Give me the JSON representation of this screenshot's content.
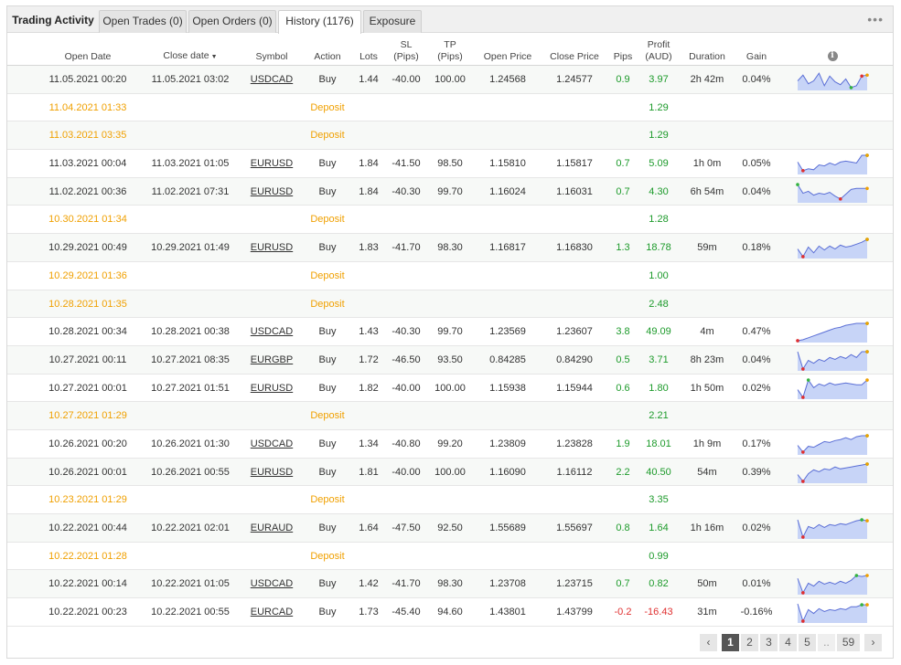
{
  "tabs": [
    {
      "label": "Trading Activity"
    },
    {
      "label": "Open Trades (0)"
    },
    {
      "label": "Open Orders (0)"
    },
    {
      "label": "History (1176)"
    },
    {
      "label": "Exposure"
    }
  ],
  "more_icon": "more-horizontal-icon",
  "columns": {
    "open_date": "Open Date",
    "close_date": "Close date",
    "symbol": "Symbol",
    "action": "Action",
    "lots": "Lots",
    "sl": "SL",
    "sl_unit": "(Pips)",
    "tp": "TP",
    "tp_unit": "(Pips)",
    "open_price": "Open Price",
    "close_price": "Close Price",
    "pips": "Pips",
    "profit": "Profit",
    "profit_unit": "(AUD)",
    "duration": "Duration",
    "gain": "Gain",
    "chart_icon": "info-icon"
  },
  "rows": [
    {
      "type": "trade",
      "open_date": "11.05.2021 00:20",
      "close_date": "11.05.2021 03:02",
      "symbol": "USDCAD",
      "action": "Buy",
      "lots": "1.44",
      "sl": "-40.00",
      "tp": "100.00",
      "open_price": "1.24568",
      "close_price": "1.24577",
      "pips": "0.9",
      "profit": "3.97",
      "duration": "2h 42m",
      "gain": "0.04%",
      "spark": [
        0.55,
        0.25,
        0.7,
        0.55,
        0.15,
        0.8,
        0.3,
        0.6,
        0.75,
        0.45,
        0.9,
        0.8,
        0.3,
        0.25
      ],
      "spark_max": 10,
      "spark_min": 12
    },
    {
      "type": "deposit",
      "open_date": "11.04.2021 01:33",
      "action": "Deposit",
      "profit": "1.29"
    },
    {
      "type": "deposit",
      "open_date": "11.03.2021 03:35",
      "action": "Deposit",
      "profit": "1.29"
    },
    {
      "type": "trade",
      "open_date": "11.03.2021 00:04",
      "close_date": "11.03.2021 01:05",
      "symbol": "EURUSD",
      "action": "Buy",
      "lots": "1.84",
      "sl": "-41.50",
      "tp": "98.50",
      "open_price": "1.15810",
      "close_price": "1.15817",
      "pips": "0.7",
      "profit": "5.09",
      "duration": "1h 0m",
      "gain": "0.05%",
      "spark": [
        0.4,
        0.85,
        0.75,
        0.8,
        0.55,
        0.6,
        0.45,
        0.55,
        0.4,
        0.35,
        0.4,
        0.45,
        0.05,
        0.05
      ],
      "spark_max": 13,
      "spark_min": 1
    },
    {
      "type": "trade",
      "open_date": "11.02.2021 00:36",
      "close_date": "11.02.2021 07:31",
      "symbol": "EURUSD",
      "action": "Buy",
      "lots": "1.84",
      "sl": "-40.30",
      "tp": "99.70",
      "open_price": "1.16024",
      "close_price": "1.16031",
      "pips": "0.7",
      "profit": "4.30",
      "duration": "6h 54m",
      "gain": "0.04%",
      "spark": [
        0.1,
        0.55,
        0.45,
        0.65,
        0.55,
        0.6,
        0.5,
        0.7,
        0.85,
        0.6,
        0.35,
        0.3,
        0.3,
        0.3
      ],
      "spark_max": 0,
      "spark_min": 8
    },
    {
      "type": "deposit",
      "open_date": "10.30.2021 01:34",
      "action": "Deposit",
      "profit": "1.28"
    },
    {
      "type": "trade",
      "open_date": "10.29.2021 00:49",
      "close_date": "10.29.2021 01:49",
      "symbol": "EURUSD",
      "action": "Buy",
      "lots": "1.83",
      "sl": "-41.70",
      "tp": "98.30",
      "open_price": "1.16817",
      "close_price": "1.16830",
      "pips": "1.3",
      "profit": "18.78",
      "duration": "59m",
      "gain": "0.18%",
      "spark": [
        0.55,
        0.95,
        0.45,
        0.75,
        0.4,
        0.6,
        0.4,
        0.55,
        0.35,
        0.45,
        0.4,
        0.3,
        0.2,
        0.05
      ],
      "spark_max": 13,
      "spark_min": 1
    },
    {
      "type": "deposit",
      "open_date": "10.29.2021 01:36",
      "action": "Deposit",
      "profit": "1.00"
    },
    {
      "type": "deposit",
      "open_date": "10.28.2021 01:35",
      "action": "Deposit",
      "profit": "2.48"
    },
    {
      "type": "trade",
      "open_date": "10.28.2021 00:34",
      "close_date": "10.28.2021 00:38",
      "symbol": "USDCAD",
      "action": "Buy",
      "lots": "1.43",
      "sl": "-40.30",
      "tp": "99.70",
      "open_price": "1.23569",
      "close_price": "1.23607",
      "pips": "3.8",
      "profit": "49.09",
      "duration": "4m",
      "gain": "0.47%",
      "spark": [
        0.95,
        0.9,
        0.8,
        0.7,
        0.6,
        0.5,
        0.4,
        0.3,
        0.25,
        0.15,
        0.1,
        0.05,
        0.05,
        0.05
      ],
      "spark_max": 13,
      "spark_min": 0
    },
    {
      "type": "trade",
      "open_date": "10.27.2021 00:11",
      "close_date": "10.27.2021 08:35",
      "symbol": "EURGBP",
      "action": "Buy",
      "lots": "1.72",
      "sl": "-46.50",
      "tp": "93.50",
      "open_price": "0.84285",
      "close_price": "0.84290",
      "pips": "0.5",
      "profit": "3.71",
      "duration": "8h 23m",
      "gain": "0.04%",
      "spark": [
        0.05,
        0.95,
        0.5,
        0.65,
        0.45,
        0.55,
        0.35,
        0.45,
        0.3,
        0.4,
        0.2,
        0.35,
        0.05,
        0.05
      ],
      "spark_max": 13,
      "spark_min": 1
    },
    {
      "type": "trade",
      "open_date": "10.27.2021 00:01",
      "close_date": "10.27.2021 01:51",
      "symbol": "EURUSD",
      "action": "Buy",
      "lots": "1.82",
      "sl": "-40.00",
      "tp": "100.00",
      "open_price": "1.15938",
      "close_price": "1.15944",
      "pips": "0.6",
      "profit": "1.80",
      "duration": "1h 50m",
      "gain": "0.02%",
      "spark": [
        0.55,
        0.95,
        0.05,
        0.45,
        0.25,
        0.35,
        0.2,
        0.3,
        0.25,
        0.2,
        0.25,
        0.3,
        0.3,
        0.05
      ],
      "spark_max": 2,
      "spark_min": 1
    },
    {
      "type": "deposit",
      "open_date": "10.27.2021 01:29",
      "action": "Deposit",
      "profit": "2.21"
    },
    {
      "type": "trade",
      "open_date": "10.26.2021 00:20",
      "close_date": "10.26.2021 01:30",
      "symbol": "USDCAD",
      "action": "Buy",
      "lots": "1.34",
      "sl": "-40.80",
      "tp": "99.20",
      "open_price": "1.23809",
      "close_price": "1.23828",
      "pips": "1.9",
      "profit": "18.01",
      "duration": "1h 9m",
      "gain": "0.17%",
      "spark": [
        0.55,
        0.9,
        0.6,
        0.65,
        0.5,
        0.35,
        0.4,
        0.3,
        0.25,
        0.15,
        0.25,
        0.1,
        0.05,
        0.05
      ],
      "spark_max": 13,
      "spark_min": 1
    },
    {
      "type": "trade",
      "open_date": "10.26.2021 00:01",
      "close_date": "10.26.2021 00:55",
      "symbol": "EURUSD",
      "action": "Buy",
      "lots": "1.81",
      "sl": "-40.00",
      "tp": "100.00",
      "open_price": "1.16090",
      "close_price": "1.16112",
      "pips": "2.2",
      "profit": "40.50",
      "duration": "54m",
      "gain": "0.39%",
      "spark": [
        0.6,
        0.95,
        0.55,
        0.35,
        0.45,
        0.3,
        0.35,
        0.2,
        0.3,
        0.25,
        0.2,
        0.15,
        0.1,
        0.05
      ],
      "spark_max": 13,
      "spark_min": 1
    },
    {
      "type": "deposit",
      "open_date": "10.23.2021 01:29",
      "action": "Deposit",
      "profit": "3.35"
    },
    {
      "type": "trade",
      "open_date": "10.22.2021 00:44",
      "close_date": "10.22.2021 02:01",
      "symbol": "EURAUD",
      "action": "Buy",
      "lots": "1.64",
      "sl": "-47.50",
      "tp": "92.50",
      "open_price": "1.55689",
      "close_price": "1.55697",
      "pips": "0.8",
      "profit": "1.64",
      "duration": "1h 16m",
      "gain": "0.02%",
      "spark": [
        0.05,
        0.95,
        0.4,
        0.5,
        0.3,
        0.45,
        0.3,
        0.35,
        0.25,
        0.3,
        0.2,
        0.1,
        0.05,
        0.1
      ],
      "spark_max": 12,
      "spark_min": 1
    },
    {
      "type": "deposit",
      "open_date": "10.22.2021 01:28",
      "action": "Deposit",
      "profit": "0.99"
    },
    {
      "type": "trade",
      "open_date": "10.22.2021 00:14",
      "close_date": "10.22.2021 01:05",
      "symbol": "USDCAD",
      "action": "Buy",
      "lots": "1.42",
      "sl": "-41.70",
      "tp": "98.30",
      "open_price": "1.23708",
      "close_price": "1.23715",
      "pips": "0.7",
      "profit": "0.82",
      "duration": "50m",
      "gain": "0.01%",
      "spark": [
        0.2,
        0.95,
        0.45,
        0.6,
        0.35,
        0.5,
        0.4,
        0.5,
        0.35,
        0.45,
        0.3,
        0.05,
        0.1,
        0.05
      ],
      "spark_max": 11,
      "spark_min": 1
    },
    {
      "type": "trade",
      "open_date": "10.22.2021 00:23",
      "close_date": "10.22.2021 00:55",
      "symbol": "EURCAD",
      "action": "Buy",
      "lots": "1.73",
      "sl": "-45.40",
      "tp": "94.60",
      "open_price": "1.43801",
      "close_price": "1.43799",
      "pips": "-0.2",
      "profit": "-16.43",
      "duration": "31m",
      "gain": "-0.16%",
      "spark": [
        0.05,
        0.95,
        0.35,
        0.55,
        0.3,
        0.45,
        0.35,
        0.4,
        0.3,
        0.35,
        0.2,
        0.2,
        0.1,
        0.1
      ],
      "spark_max": 12,
      "spark_min": 1
    }
  ],
  "pagination": {
    "prev_icon": "chevron-left-icon",
    "pages": [
      "1",
      "2",
      "3",
      "4",
      "5"
    ],
    "current": "1",
    "ellipsis": "..",
    "last": "59",
    "next_icon": "chevron-right-icon"
  },
  "colors": {
    "positive": "#1c9a2a",
    "negative": "#e03030",
    "deposit": "#f0a000",
    "spark_fill": "#c7d4f7",
    "spark_line": "#5b6fd6",
    "spark_max_dot": "#33b340",
    "spark_min_dot": "#e03030",
    "spark_end_dot": "#f0a000"
  }
}
